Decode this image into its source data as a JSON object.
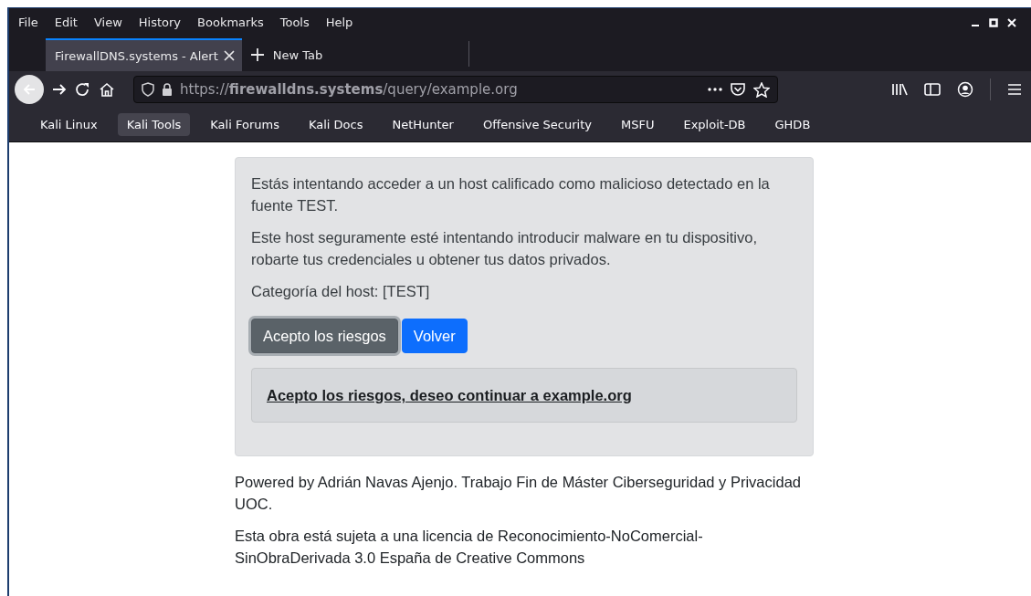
{
  "menu_bar": {
    "items": [
      "File",
      "Edit",
      "View",
      "History",
      "Bookmarks",
      "Tools",
      "Help"
    ]
  },
  "tabs": [
    {
      "label": "FirewallDNS.systems - Alert",
      "selected": true
    }
  ],
  "new_tab_button": {
    "label": "New Tab"
  },
  "address_bar": {
    "url": "https://**firewalldns.systems**/query/example.org"
  },
  "bookmarks": [
    {
      "label": "Kali Linux",
      "hovered": false
    },
    {
      "label": "Kali Tools",
      "hovered": true
    },
    {
      "label": "Kali Forums",
      "hovered": false
    },
    {
      "label": "Kali Docs",
      "hovered": false
    },
    {
      "label": "NetHunter",
      "hovered": false
    },
    {
      "label": "Offensive Security",
      "hovered": false
    },
    {
      "label": "MSFU",
      "hovered": false
    },
    {
      "label": "Exploit-DB",
      "hovered": false
    },
    {
      "label": "GHDB",
      "hovered": false
    }
  ],
  "alert": {
    "paragraphs": [
      "Estás intentando acceder a un host calificado como malicioso detectado en la fuente TEST.",
      "Este host seguramente esté intentando introducir malware en tu dispositivo, robarte tus credenciales u obtener tus datos privados.",
      "Categoría del host: [TEST]"
    ],
    "buttons": [
      {
        "label": "Acepto los riesgos",
        "kind": "secondary",
        "focused": true
      },
      {
        "label": "Volver",
        "kind": "primary",
        "focused": false
      }
    ],
    "continue_link": "Acepto los riesgos, deseo continuar a example.org"
  },
  "footer": [
    "Powered by Adrián Navas Ajenjo. Trabajo Fin de Máster Ciberseguridad y Privacidad UOC.",
    "Esta obra está sujeta a una licencia de Reconocimiento-NoComercial-SinObraDerivada 3.0 España de Creative Commons"
  ]
}
